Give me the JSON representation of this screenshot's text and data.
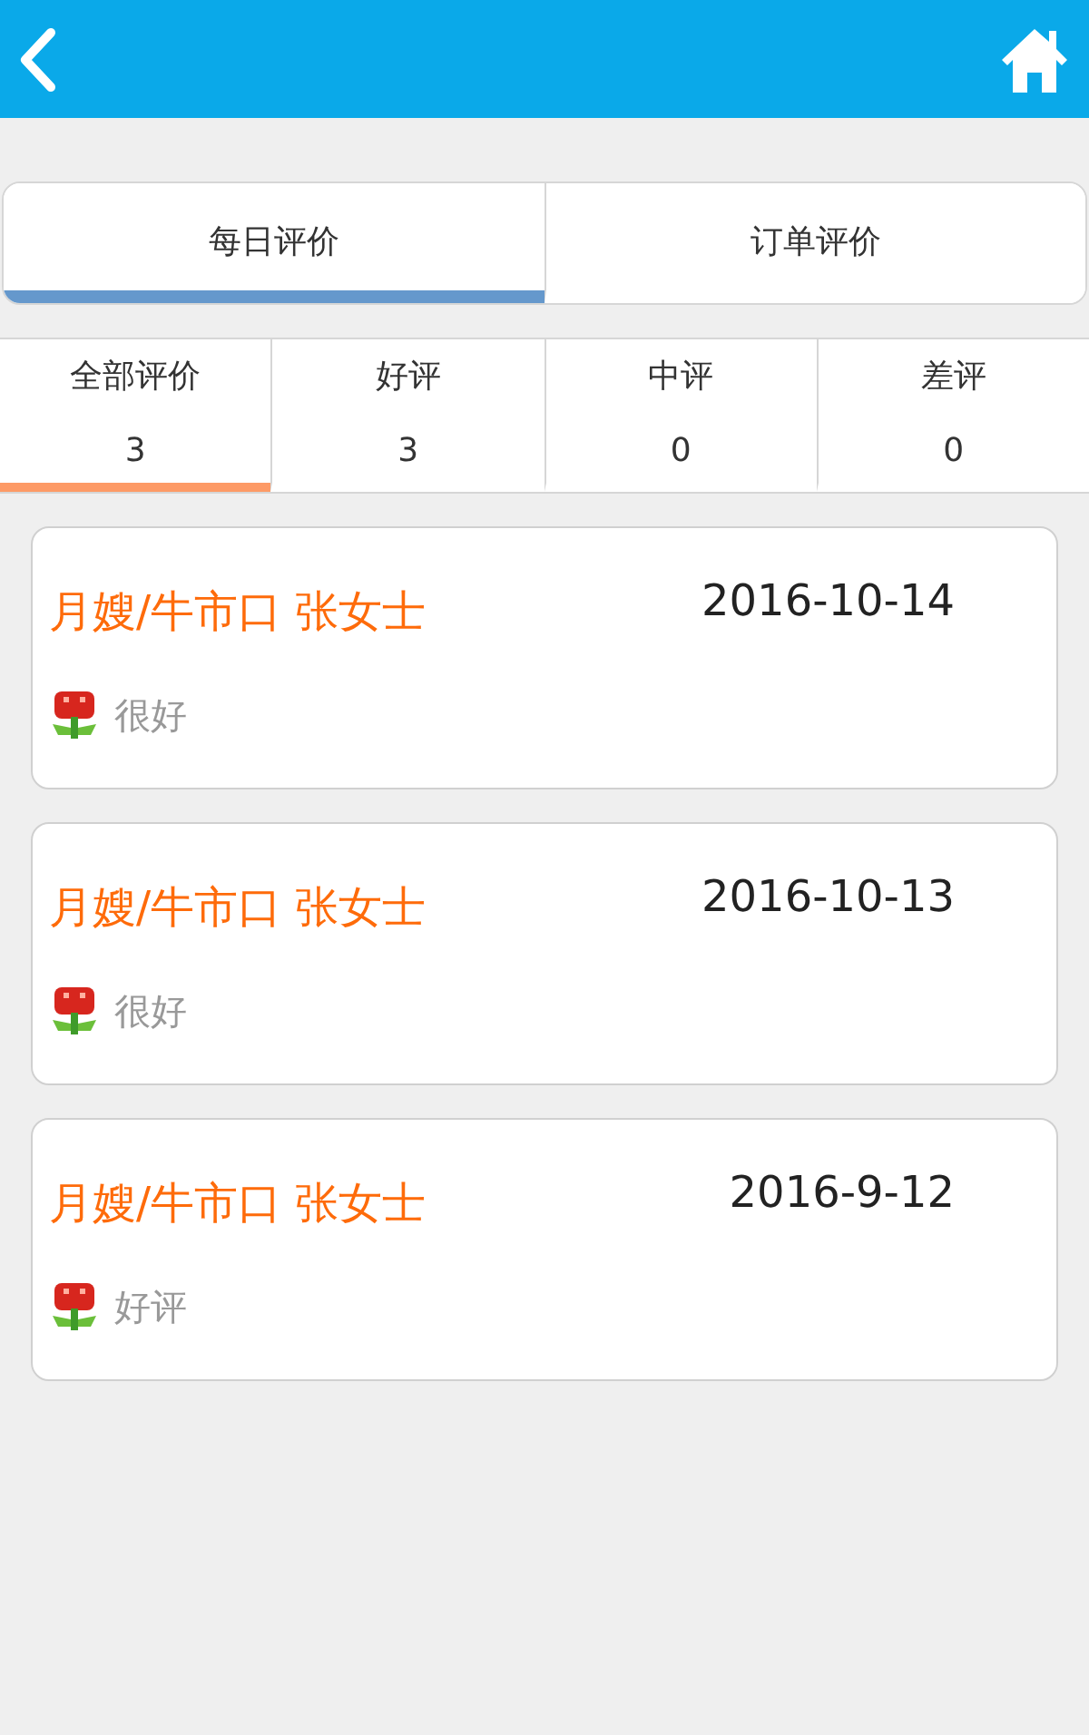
{
  "tabs": [
    {
      "label": "每日评价",
      "selected": true
    },
    {
      "label": "订单评价",
      "selected": false
    }
  ],
  "filters": [
    {
      "label": "全部评价",
      "count": "3",
      "selected": true
    },
    {
      "label": "好评",
      "count": "3",
      "selected": false
    },
    {
      "label": "中评",
      "count": "0",
      "selected": false
    },
    {
      "label": "差评",
      "count": "0",
      "selected": false
    }
  ],
  "reviews": [
    {
      "name": "月嫂/牛市口 张女士",
      "date": "2016-10-14",
      "comment": "很好"
    },
    {
      "name": "月嫂/牛市口 张女士",
      "date": "2016-10-13",
      "comment": "很好"
    },
    {
      "name": "月嫂/牛市口 张女士",
      "date": "2016-9-12",
      "comment": "好评"
    }
  ]
}
